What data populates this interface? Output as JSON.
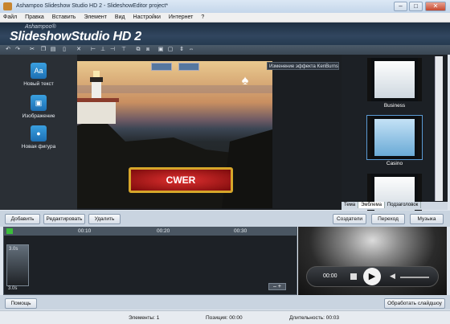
{
  "window": {
    "title": "Ashampoo Slideshow Studio HD 2 - SlideshowEditor project*"
  },
  "menu": [
    "Файл",
    "Правка",
    "Вставить",
    "Элемент",
    "Вид",
    "Настройки",
    "Интернет",
    "?"
  ],
  "banner": {
    "brand_small": "Ashampoo®",
    "brand": "SlideshowStudio HD 2"
  },
  "tools": [
    {
      "label": "Новый текст",
      "icon": "text-icon"
    },
    {
      "label": "Изображение",
      "icon": "image-icon"
    },
    {
      "label": "Новая фигура",
      "icon": "shapes-icon"
    }
  ],
  "stage": {
    "effect_label": "Изменение эффекта KenBurns",
    "slide_text": "CWER"
  },
  "themes": {
    "items": [
      {
        "label": "Business"
      },
      {
        "label": "Casino"
      },
      {
        "label": ""
      }
    ],
    "tabs": [
      "Тема",
      "Эмблема",
      "Подзаголовок"
    ]
  },
  "actions": {
    "add": "Добавить",
    "edit": "Редактировать",
    "delete": "Удалить",
    "creators": "Создатели",
    "transition": "Переход",
    "music": "Музыка"
  },
  "timeline": {
    "marks": [
      "00:10",
      "00:20",
      "00:30"
    ],
    "clip_duration": "3.0s",
    "clip_end": "3.0s"
  },
  "player": {
    "time": "00:00"
  },
  "bottom": {
    "help": "Помощь",
    "process": "Обработать слайдшоу"
  },
  "status": {
    "elements": "Элементы: 1",
    "position": "Позиция: 00:00",
    "duration": "Длительность: 00:03"
  }
}
